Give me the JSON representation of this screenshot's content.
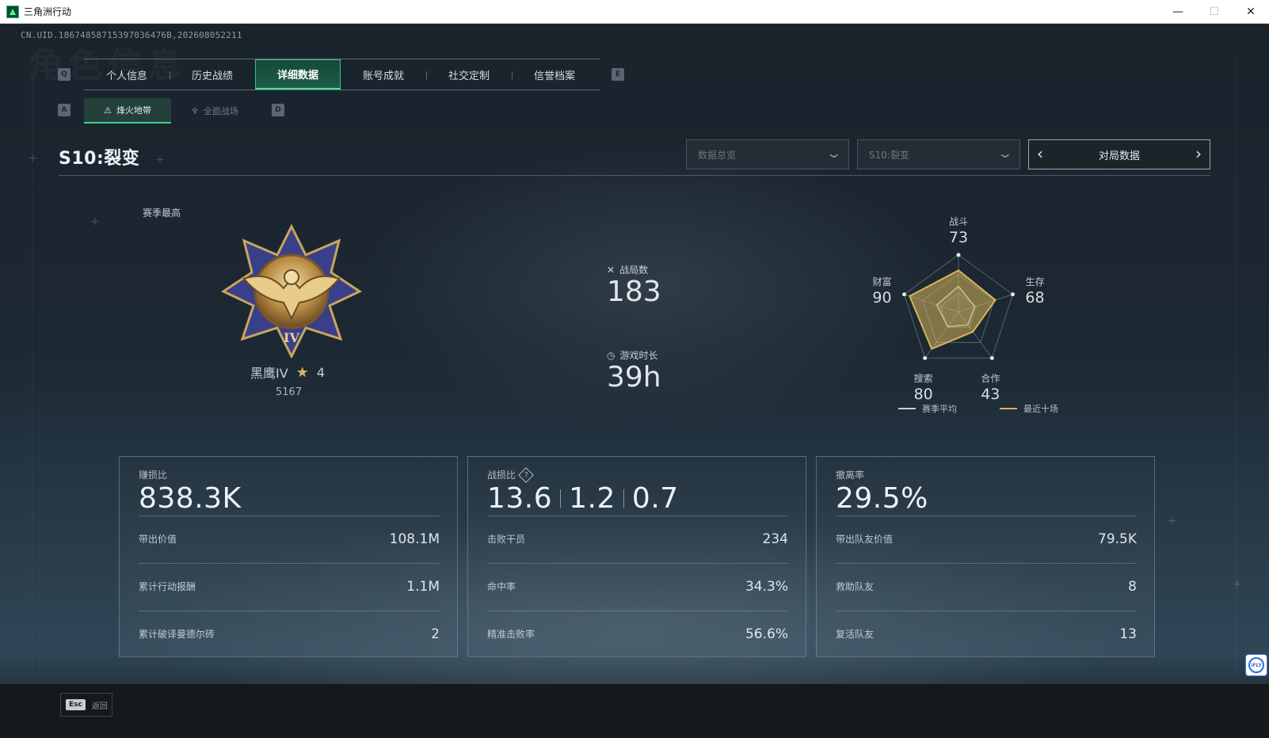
{
  "window": {
    "title": "三角洲行动",
    "minimize": "—",
    "maximize": "☐",
    "close": "✕"
  },
  "uid": "CN.UID.18674858715397036476B,202608052211",
  "watermark": "角色信息",
  "tabs": {
    "left_key": "Q",
    "right_key": "E",
    "items": [
      {
        "label": "个人信息",
        "active": false
      },
      {
        "label": "历史战绩",
        "active": false
      },
      {
        "label": "详细数据",
        "active": true
      },
      {
        "label": "账号成就",
        "active": false
      },
      {
        "label": "社交定制",
        "active": false
      },
      {
        "label": "信誉档案",
        "active": false
      }
    ]
  },
  "subtabs": {
    "left_key": "A",
    "right_key": "D",
    "items": [
      {
        "label": "烽火地带",
        "icon": "⚠",
        "active": true
      },
      {
        "label": "全面战场",
        "icon": "♆",
        "active": false
      }
    ]
  },
  "season": {
    "title": "S10:裂变",
    "dropdown_overview": "数据总览",
    "dropdown_season": "S10:裂变",
    "pager_label": "对局数据",
    "pager_prev": "‹",
    "pager_next": "›"
  },
  "rank": {
    "best_label": "赛季最高",
    "name": "黑鹰IV",
    "stars": "4",
    "score": "5167",
    "emblem_numeral": "IV"
  },
  "stats": {
    "matches_label": "战局数",
    "matches_value": "183",
    "playtime_label": "游戏时长",
    "playtime_value": "39h"
  },
  "radar": {
    "axes": [
      {
        "label": "战斗",
        "value": "73",
        "num": 73
      },
      {
        "label": "生存",
        "value": "68",
        "num": 68
      },
      {
        "label": "合作",
        "value": "43",
        "num": 43
      },
      {
        "label": "搜索",
        "value": "80",
        "num": 80
      },
      {
        "label": "财富",
        "value": "90",
        "num": 90
      }
    ],
    "recent": [
      0.73,
      0.68,
      0.43,
      0.8,
      0.9
    ],
    "season_avg": [
      0.45,
      0.3,
      0.28,
      0.32,
      0.4
    ],
    "legend_avg": "赛季平均",
    "legend_recent": "最近十场",
    "avg_color": "#c9d1d6",
    "recent_color": "#d6b45a"
  },
  "cards": [
    {
      "title": "赚损比",
      "big": "838.3K",
      "rows": [
        {
          "label": "带出价值",
          "value": "108.1M"
        },
        {
          "label": "累计行动报酬",
          "value": "1.1M"
        },
        {
          "label": "累计破译曼德尔砖",
          "value": "2"
        }
      ]
    },
    {
      "title": "战损比",
      "help": "?",
      "big_parts": [
        "13.6",
        "1.2",
        "0.7"
      ],
      "rows": [
        {
          "label": "击败干员",
          "value": "234"
        },
        {
          "label": "命中率",
          "value": "34.3%"
        },
        {
          "label": "精准击败率",
          "value": "56.6%"
        }
      ]
    },
    {
      "title": "撤离率",
      "big": "29.5%",
      "rows": [
        {
          "label": "带出队友价值",
          "value": "79.5K"
        },
        {
          "label": "救助队友",
          "value": "8"
        },
        {
          "label": "复活队友",
          "value": "13"
        }
      ]
    }
  ],
  "footer": {
    "esc_key": "Esc",
    "esc_label": "返回",
    "ifly": "iFLY"
  }
}
